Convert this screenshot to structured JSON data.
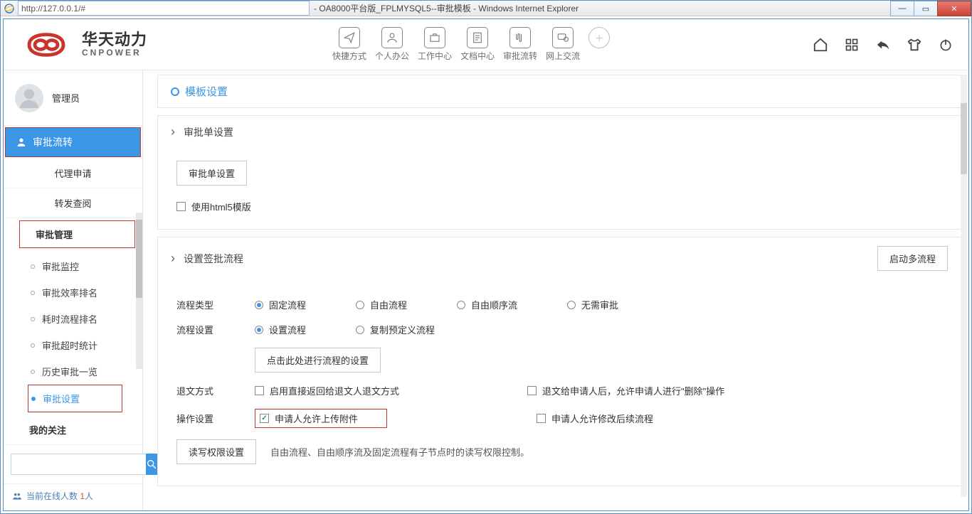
{
  "window": {
    "url": "http://127.0.0.1/#",
    "title": "- OA8000平台版_FPLMYSQL5--审批模板 - Windows Internet Explorer"
  },
  "brand": {
    "name": "华天动力",
    "sub": "CNPOWER"
  },
  "topnav": [
    {
      "label": "快捷方式"
    },
    {
      "label": "个人办公"
    },
    {
      "label": "工作中心"
    },
    {
      "label": "文档中心"
    },
    {
      "label": "审批流转"
    },
    {
      "label": "网上交流"
    }
  ],
  "user": {
    "name": "管理员"
  },
  "sidebar": {
    "section_title": "审批流转",
    "items": [
      "代理申请",
      "转发查阅"
    ],
    "group_title": "审批管理",
    "group_items": [
      "审批监控",
      "审批效率排名",
      "耗时流程排名",
      "审批超时统计",
      "历史审批一览",
      "审批设置"
    ],
    "my_follow": "我的关注"
  },
  "online": {
    "label_prefix": "当前在线人数 ",
    "count": "1",
    "suffix": "人"
  },
  "main": {
    "template_settings_title": "模板设置",
    "form_settings_title": "审批单设置",
    "btn_form_settings": "审批单设置",
    "use_html5": "使用html5模版",
    "signflow_title": "设置签批流程",
    "btn_multi": "启动多流程",
    "row_type_label": "流程类型",
    "type_options": [
      "固定流程",
      "自由流程",
      "自由顺序流",
      "无需审批"
    ],
    "row_setting_label": "流程设置",
    "setting_options": [
      "设置流程",
      "复制预定义流程"
    ],
    "btn_click_set": "点击此处进行流程的设置",
    "row_reject_label": "退文方式",
    "reject_opt1": "启用直接返回给退文人退文方式",
    "reject_opt2": "退文给申请人后，允许申请人进行\"删除\"操作",
    "row_op_label": "操作设置",
    "op_opt1": "申请人允许上传附件",
    "op_opt2": "申请人允许修改后续流程",
    "btn_rw": "读写权限设置",
    "rw_note": "自由流程、自由顺序流及固定流程有子节点时的读写权限控制。"
  }
}
